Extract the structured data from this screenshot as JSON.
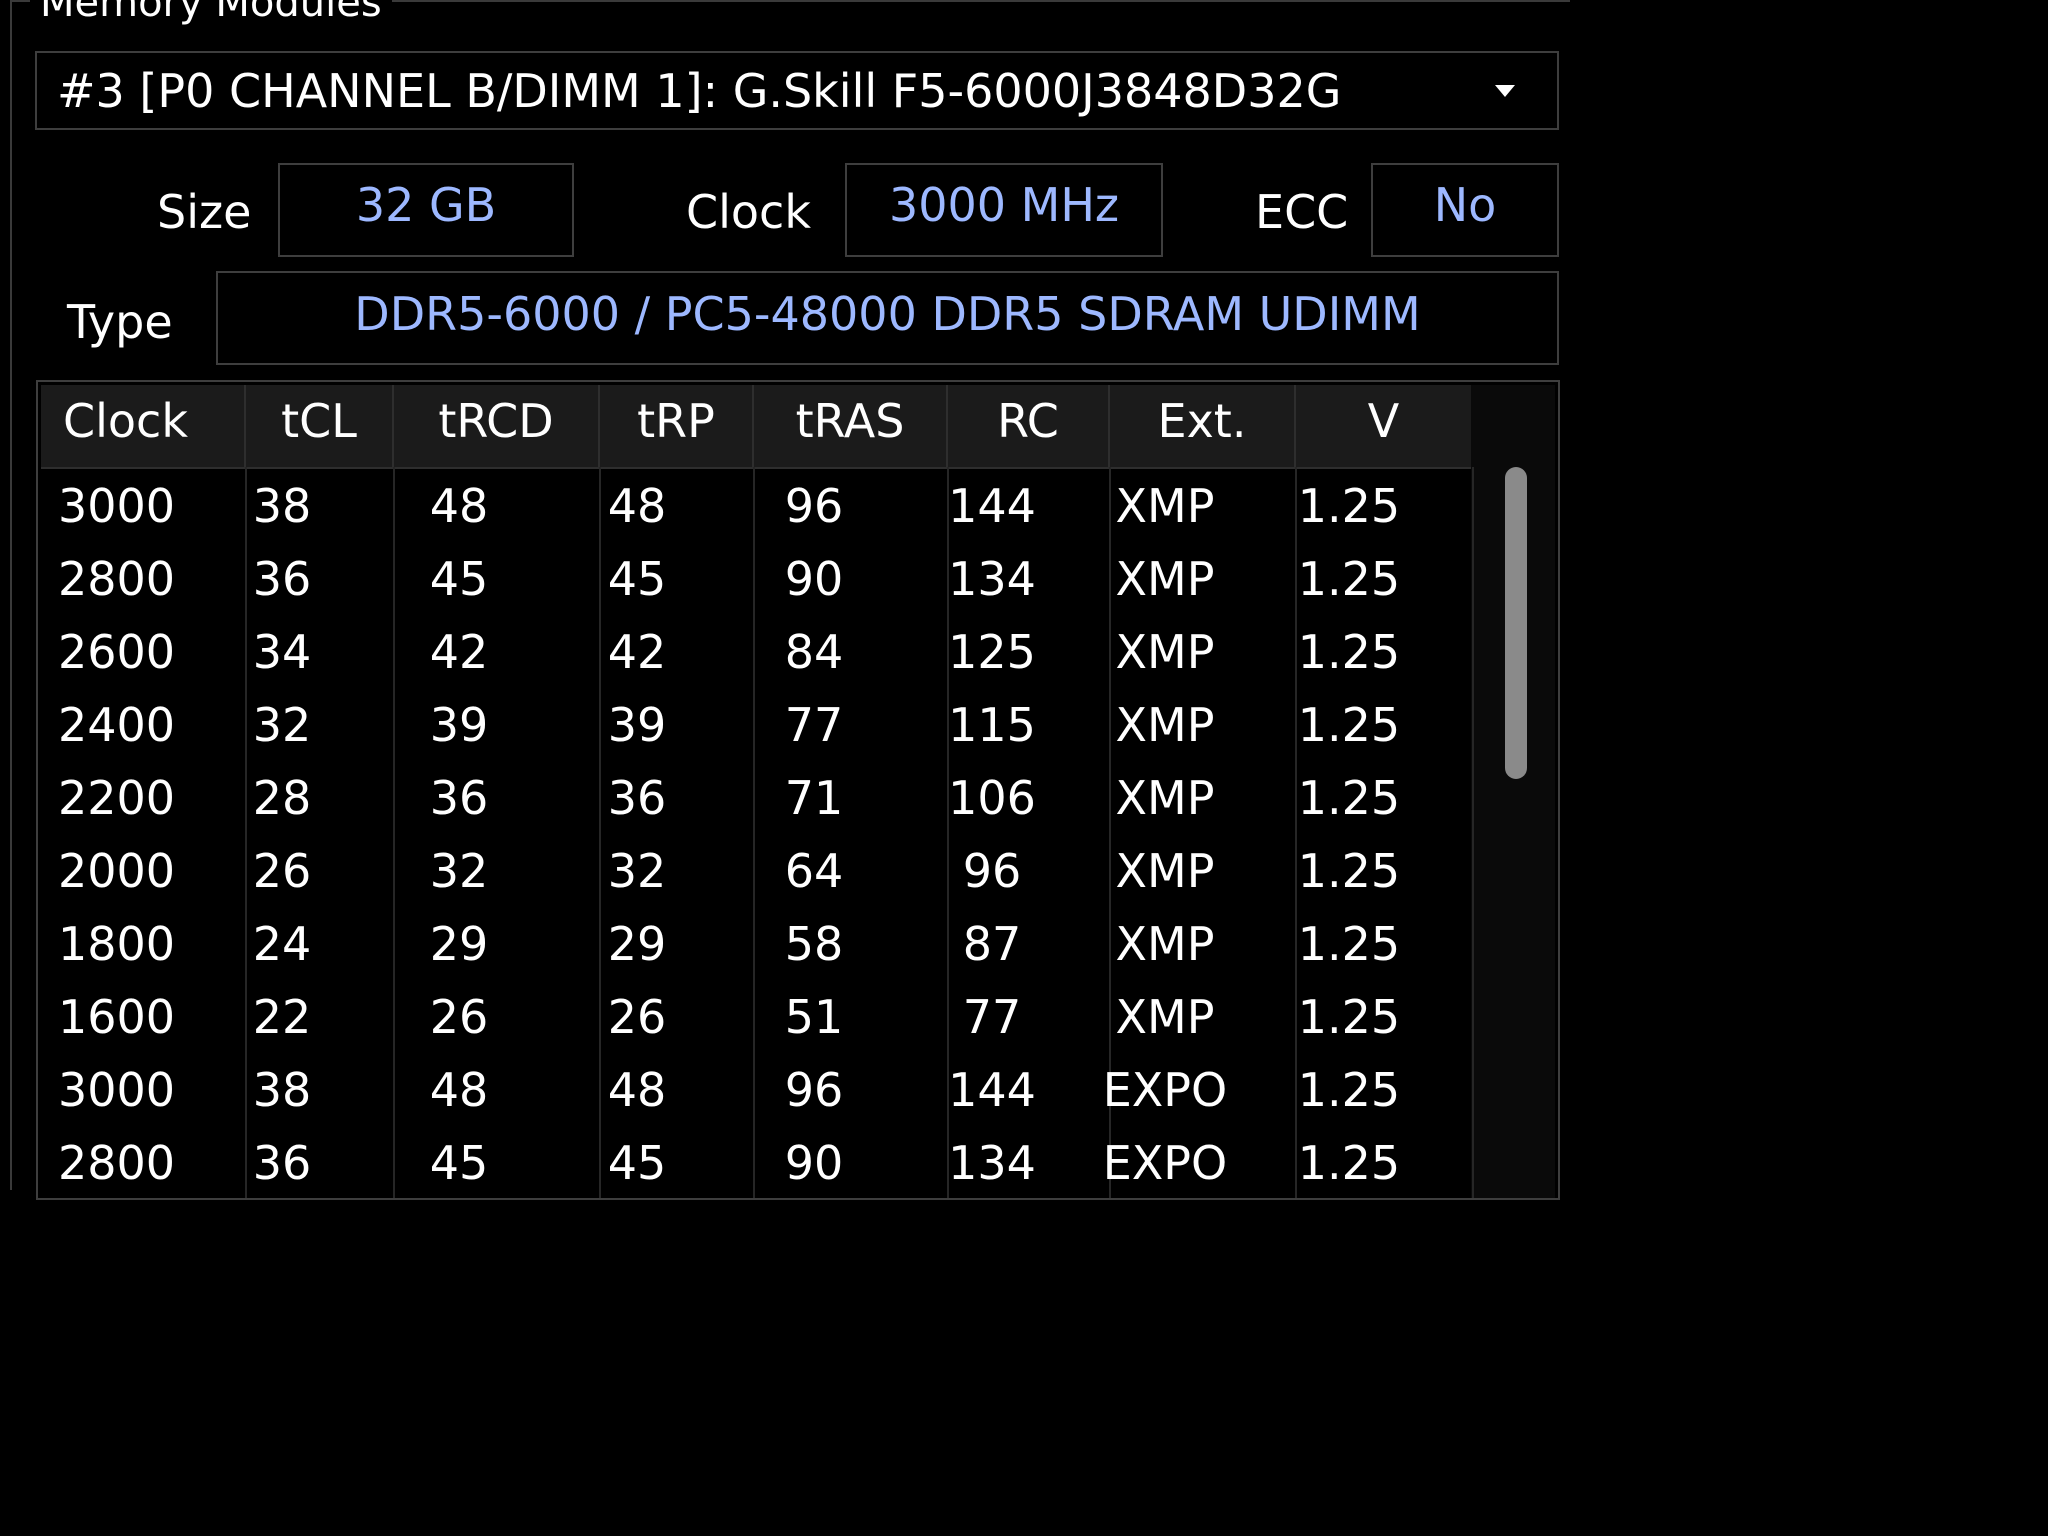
{
  "group_title": "Memory Modules",
  "module_selector": {
    "value": "#3 [P0 CHANNEL B/DIMM 1]: G.Skill F5-6000J3848D32G"
  },
  "fields": {
    "size_label": "Size",
    "size_value": "32 GB",
    "clock_label": "Clock",
    "clock_value": "3000 MHz",
    "ecc_label": "ECC",
    "ecc_value": "No",
    "type_label": "Type",
    "type_value": "DDR5-6000 / PC5-48000 DDR5 SDRAM UDIMM"
  },
  "timings_table": {
    "columns": [
      "Clock",
      "tCL",
      "tRCD",
      "tRP",
      "tRAS",
      "RC",
      "Ext.",
      "V"
    ],
    "rows": [
      [
        "3000",
        "38",
        "48",
        "48",
        "96",
        "144",
        "XMP",
        "1.25"
      ],
      [
        "2800",
        "36",
        "45",
        "45",
        "90",
        "134",
        "XMP",
        "1.25"
      ],
      [
        "2600",
        "34",
        "42",
        "42",
        "84",
        "125",
        "XMP",
        "1.25"
      ],
      [
        "2400",
        "32",
        "39",
        "39",
        "77",
        "115",
        "XMP",
        "1.25"
      ],
      [
        "2200",
        "28",
        "36",
        "36",
        "71",
        "106",
        "XMP",
        "1.25"
      ],
      [
        "2000",
        "26",
        "32",
        "32",
        "64",
        "96",
        "XMP",
        "1.25"
      ],
      [
        "1800",
        "24",
        "29",
        "29",
        "58",
        "87",
        "XMP",
        "1.25"
      ],
      [
        "1600",
        "22",
        "26",
        "26",
        "51",
        "77",
        "XMP",
        "1.25"
      ],
      [
        "3000",
        "38",
        "48",
        "48",
        "96",
        "144",
        "EXPO",
        "1.25"
      ],
      [
        "2800",
        "36",
        "45",
        "45",
        "90",
        "134",
        "EXPO",
        "1.25"
      ]
    ]
  },
  "colors": {
    "background": "#000000",
    "value_text": "#9db8ff",
    "border": "#3e3e3e"
  }
}
